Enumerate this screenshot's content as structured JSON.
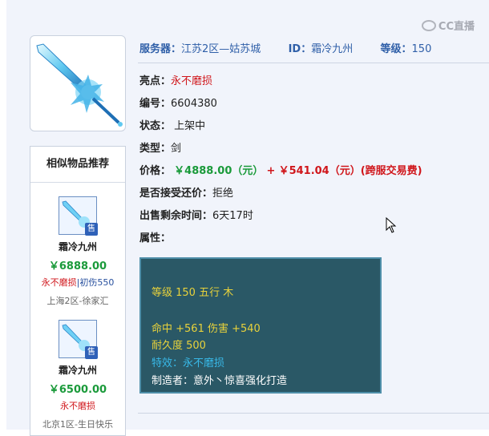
{
  "watermark": "CC直播",
  "header": {
    "server_label": "服务器：",
    "server_value": "江苏2区—姑苏城",
    "id_label": "ID：",
    "id_value": "霜冷九州",
    "level_label": "等级：",
    "level_value": "150"
  },
  "details": {
    "highlight_label": "亮点：",
    "highlight_value": "永不磨损",
    "number_label": "编号：",
    "number_value": "6604380",
    "status_label": "状态：",
    "status_value": "上架中",
    "type_label": "类型：",
    "type_value": "剑",
    "price_label": "价格：",
    "price_value": "￥4888.00（元）",
    "price_plus": "+",
    "fee_value": "￥541.04（元）(跨服交易费)",
    "counter_label": "是否接受还价：",
    "counter_value": "拒绝",
    "remaining_label": "出售剩余时间：",
    "remaining_value": "6天17时",
    "attr_label": "属性："
  },
  "attributes": {
    "line1": "等级 150 五行 木",
    "line2": "命中 +561 伤害 +540",
    "line3": "耐久度 500",
    "line4": "特效：永不磨损",
    "line5": "制造者：意外丶惊喜强化打造"
  },
  "similar": {
    "title": "相似物品推荐",
    "sell_tag": "售",
    "items": [
      {
        "name": "霜冷九州",
        "price": "￥6888.00",
        "attr_red": "永不磨损",
        "attr_sep": "|",
        "attr_blue": "初伤550",
        "server": "上海2区-徐家汇"
      },
      {
        "name": "霜冷九州",
        "price": "￥6500.00",
        "attr_red": "永不磨损",
        "attr_sep": "",
        "attr_blue": "",
        "server": "北京1区-生日快乐"
      }
    ]
  }
}
